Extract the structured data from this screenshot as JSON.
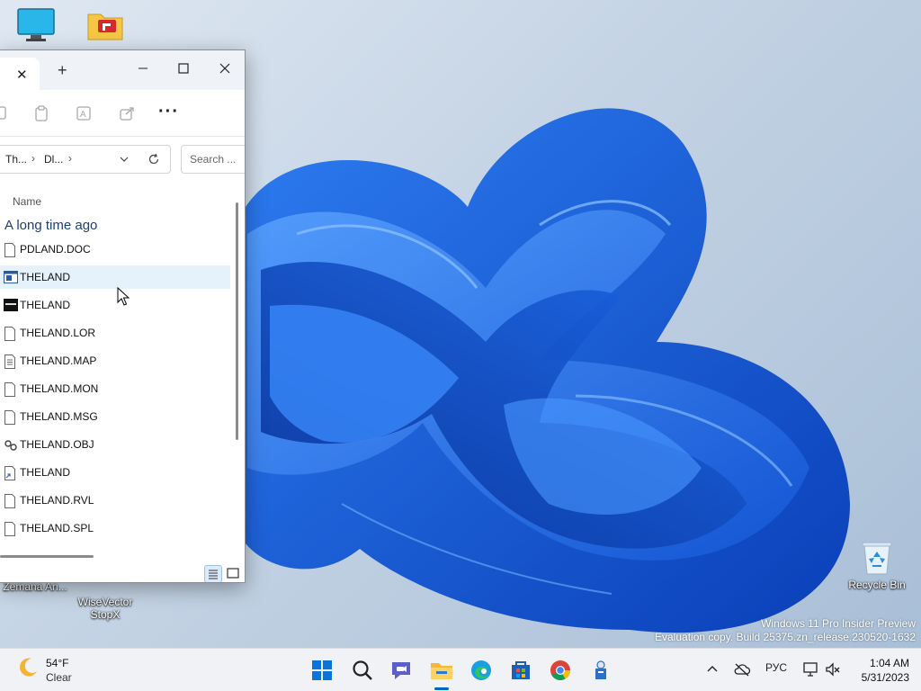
{
  "desktop": {
    "icons": [
      {
        "label": "Zemana AntiMalware",
        "display_label": "Zemana An...",
        "icon": "monitor-icon"
      },
      {
        "label": "WiseVector StopX",
        "display_label": "WiseVector\nStopX",
        "icon": "folder-icon"
      },
      {
        "label": "Recycle Bin",
        "icon": "recycle-bin-icon"
      }
    ],
    "watermark_line1": "Windows 11 Pro Insider Preview",
    "watermark_line2": "Evaluation copy. Build 25375.zn_release.230520-1632"
  },
  "explorer": {
    "tab_close": "✕",
    "tab_add": "+",
    "controls": {
      "minimize": "—",
      "maximize": "☐",
      "close": "✕"
    },
    "command_bar": {
      "more": "···"
    },
    "address": {
      "crumbs": [
        "Th...",
        "Dl..."
      ],
      "separator": "›"
    },
    "search_placeholder": "Search ...",
    "column_header": "Name",
    "group_title": "A long time ago",
    "files": [
      {
        "name": "PDLAND.DOC",
        "icon": "document-icon"
      },
      {
        "name": "THELAND",
        "icon": "application-icon",
        "hover": true
      },
      {
        "name": "THELAND",
        "icon": "dos-icon"
      },
      {
        "name": "THELAND.LOR",
        "icon": "file-icon"
      },
      {
        "name": "THELAND.MAP",
        "icon": "text-file-icon"
      },
      {
        "name": "THELAND.MON",
        "icon": "file-icon"
      },
      {
        "name": "THELAND.MSG",
        "icon": "file-icon"
      },
      {
        "name": "THELAND.OBJ",
        "icon": "object-file-icon"
      },
      {
        "name": "THELAND",
        "icon": "shortcut-icon"
      },
      {
        "name": "THELAND.RVL",
        "icon": "file-icon"
      },
      {
        "name": "THELAND.SPL",
        "icon": "file-icon"
      }
    ]
  },
  "taskbar": {
    "weather": {
      "temp": "54°F",
      "condition": "Clear"
    },
    "language": "РУС",
    "time": "1:04 AM",
    "date": "5/31/2023",
    "apps": [
      "start",
      "search",
      "chat",
      "file-explorer",
      "edge",
      "store",
      "chrome",
      "tool"
    ],
    "colors": {
      "accent": "#0067c0"
    }
  }
}
